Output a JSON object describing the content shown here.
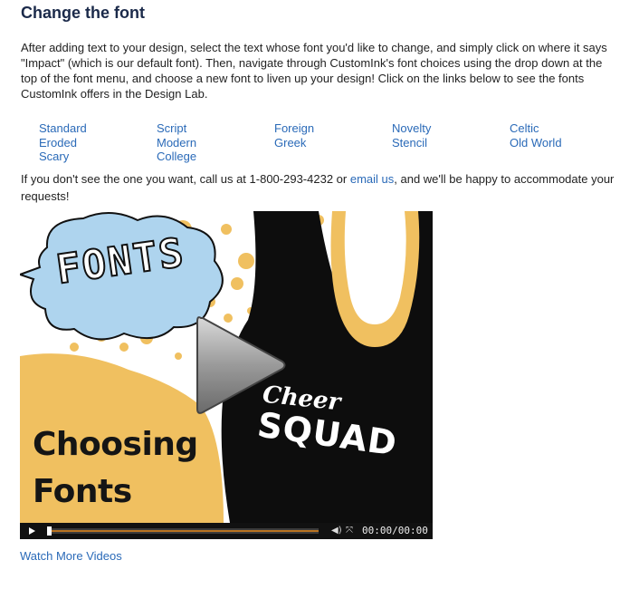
{
  "title": "Change the font",
  "intro": "After adding text to your design, select the text whose font you'd like to change, and simply click on where it says \"Impact\" (which is our default font). Then, navigate through CustomInk's font choices using the drop down at the top of the font menu, and choose a new font to liven up your design! Click on the links below to see the fonts CustomInk offers in the Design Lab.",
  "font_links": {
    "col1": [
      "Standard",
      "Eroded",
      "Scary"
    ],
    "col2": [
      "Script",
      "Modern",
      "College"
    ],
    "col3": [
      "Foreign",
      "Greek"
    ],
    "col4": [
      "Novelty",
      "Stencil"
    ],
    "col5": [
      "Celtic",
      "Old World"
    ]
  },
  "contact": {
    "before": "If you don't see the one you want, call us at 1-800-293-4232 or ",
    "link": "email us",
    "after": ", and we'll be happy to accommodate your requests!"
  },
  "video": {
    "logo_text": "FONTS",
    "headline_line1": "Choosing",
    "headline_line2": "Fonts",
    "shirt_text_1": "Cheer",
    "shirt_text_2": "SQUAD",
    "time": "00:00/00:00",
    "progress": 0,
    "colors": {
      "gold": "#f0c060",
      "cloud": "#aed4ee",
      "shirt": "#0d0d0d"
    }
  },
  "watch_more": "Watch More Videos"
}
